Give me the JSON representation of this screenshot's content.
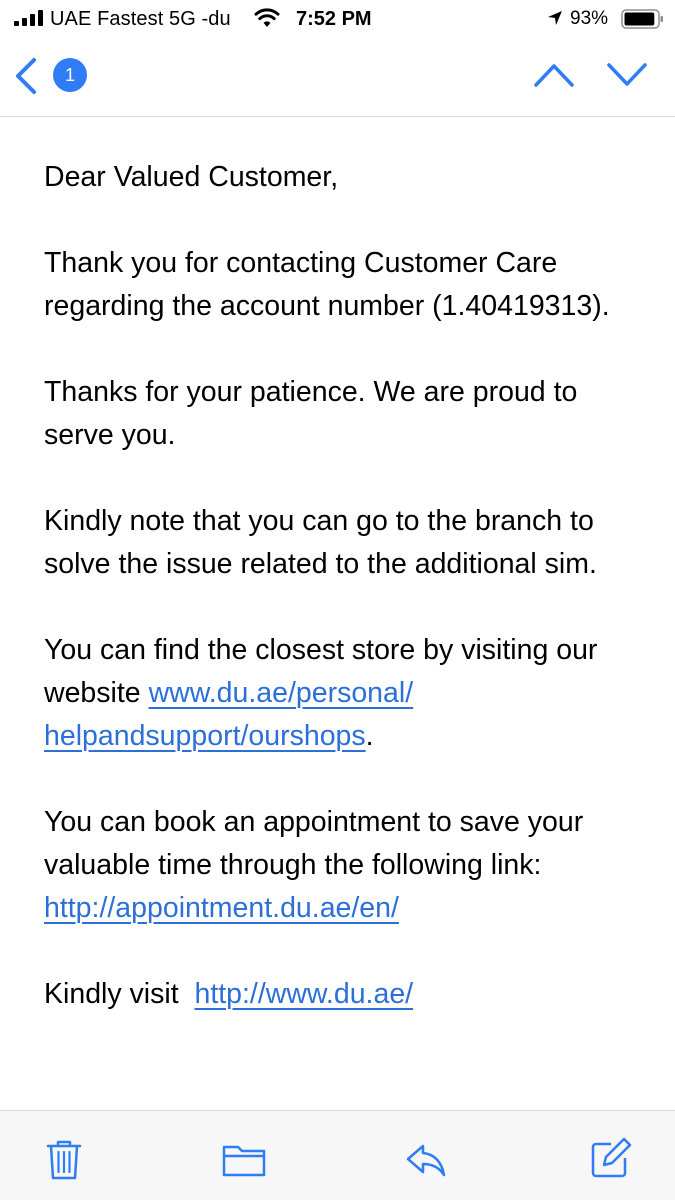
{
  "status_bar": {
    "carrier": "UAE Fastest 5G -du",
    "time": "7:52 PM",
    "battery": "93%",
    "battery_level": 0.93,
    "icons": [
      "signal-icon",
      "wifi-icon",
      "location-arrow-icon",
      "battery-icon"
    ]
  },
  "nav": {
    "back_icon": "chevron-left-icon",
    "unread_count": "1",
    "previous_icon": "chevron-up-icon",
    "next_icon": "chevron-down-icon"
  },
  "email": {
    "greeting": "Dear Valued Customer,",
    "para1": "Thank you for contacting Customer Care regarding the account number (1.40419313).",
    "para2": "Thanks for your patience. We are proud to serve you.",
    "para3": "Kindly note that you can go to the branch to solve the issue related to the additional sim.",
    "para4_text": "You can find the closest store by visiting our website ",
    "para4_link_line1": "www.du.ae/personal/",
    "para4_link_line2": "helpandsupport/ourshops",
    "para4_end": ".",
    "para5_text": "You can book an appointment to save your valuable time through the following link: ",
    "para5_link": "http://appointment.du.ae/en/",
    "para6_text": "Kindly visit  ",
    "para6_link": "http://www.du.ae/"
  },
  "toolbar": {
    "icons": [
      "trash-icon",
      "folder-icon",
      "reply-icon",
      "compose-icon"
    ]
  },
  "colors": {
    "accent": "#2e7cf6",
    "link": "#2c6fd8",
    "toolbar_bg": "#f7f7f7"
  }
}
